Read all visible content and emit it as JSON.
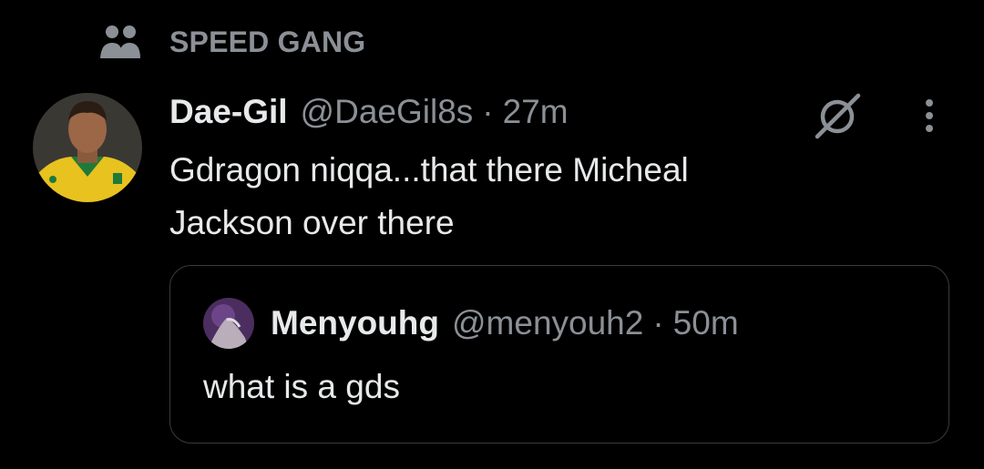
{
  "context": {
    "icon": "community-icon",
    "label": "SPEED GANG"
  },
  "tweet": {
    "author_name": "Dae-Gil",
    "author_handle": "@DaeGil8s",
    "separator": "·",
    "time": "27m",
    "text_line1": "Gdragon niqqa...that there Micheal",
    "text_line2": "Jackson over there",
    "icons": [
      "grok-icon",
      "more-vertical-icon"
    ]
  },
  "quote": {
    "author_name": "Menyouhg",
    "author_handle": "@menyouh2",
    "separator": "·",
    "time": "50m",
    "text": "what is a gds"
  },
  "colors": {
    "background": "#000000",
    "primary_text": "#e7e9ea",
    "secondary_text": "#8b9096",
    "border": "#373c41"
  }
}
